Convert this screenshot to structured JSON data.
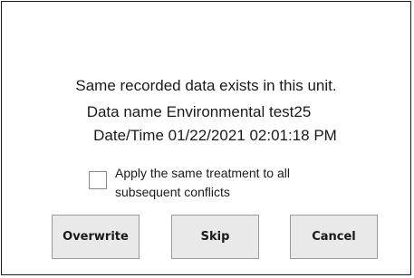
{
  "dialog": {
    "message_line1": "Same recorded data exists in this unit.",
    "message_line2": "Data name Environmental test25",
    "message_line3": "Date/Time 01/22/2021 02:01:18 PM",
    "checkbox": {
      "label_line1": "Apply the same treatment to all",
      "label_line2": "subsequent conflicts",
      "checked": false
    },
    "buttons": {
      "overwrite": "Overwrite",
      "skip": "Skip",
      "cancel": "Cancel"
    }
  },
  "colors": {
    "border": "#1a1a1a",
    "button_bg": "#e9e9e9",
    "button_border": "#9a9a9a",
    "checkbox_border": "#8a8a8a"
  }
}
